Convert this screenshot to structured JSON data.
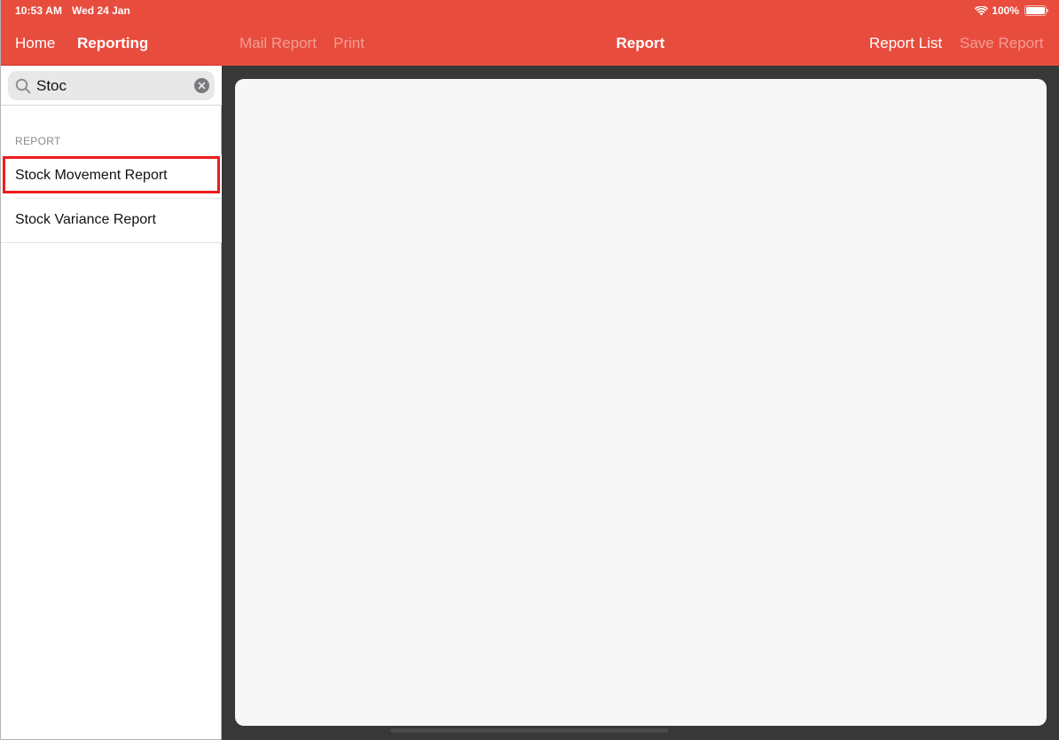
{
  "status_bar": {
    "time": "10:53 AM",
    "date": "Wed 24 Jan",
    "battery_percent": "100%",
    "battery_level": 1.0,
    "wifi_icon": "wifi-icon",
    "battery_icon": "battery-icon"
  },
  "sidebar": {
    "nav": {
      "home_label": "Home",
      "reporting_label": "Reporting"
    },
    "search": {
      "value": "Stoc",
      "placeholder": "Search",
      "icon": "search-icon",
      "clear_icon": "clear-icon"
    },
    "section_label": "REPORT",
    "items": [
      {
        "label": "Stock Movement Report",
        "highlighted": true
      },
      {
        "label": "Stock Variance Report",
        "highlighted": false
      }
    ]
  },
  "header": {
    "mail_report_label": "Mail Report",
    "print_label": "Print",
    "title": "Report",
    "report_list_label": "Report List",
    "save_report_label": "Save Report"
  },
  "colors": {
    "brand": "#e84c3d",
    "highlight": "#ee1c1c",
    "content_bg": "#383838",
    "panel_bg": "#f7f7f7"
  }
}
